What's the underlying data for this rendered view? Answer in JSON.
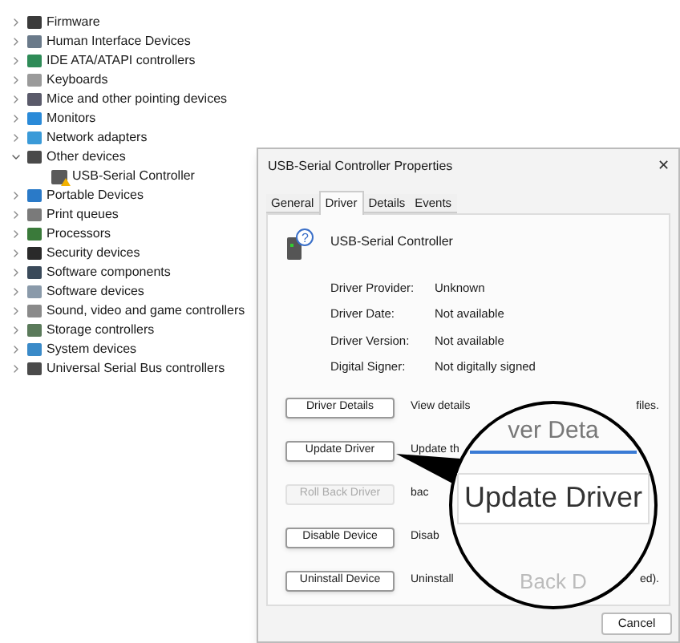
{
  "tree": [
    {
      "label": "Firmware",
      "expanded": false,
      "color": "#3a3a3a"
    },
    {
      "label": "Human Interface Devices",
      "expanded": false,
      "color": "#6a7a8a"
    },
    {
      "label": "IDE ATA/ATAPI controllers",
      "expanded": false,
      "color": "#2e8b57"
    },
    {
      "label": "Keyboards",
      "expanded": false,
      "color": "#9a9a9a"
    },
    {
      "label": "Mice and other pointing devices",
      "expanded": false,
      "color": "#5a5a6a"
    },
    {
      "label": "Monitors",
      "expanded": false,
      "color": "#2a8ad8"
    },
    {
      "label": "Network adapters",
      "expanded": false,
      "color": "#3a9ad8"
    },
    {
      "label": "Other devices",
      "expanded": true,
      "color": "#4a4a4a",
      "children": [
        {
          "label": "USB-Serial Controller",
          "warning": true
        }
      ]
    },
    {
      "label": "Portable Devices",
      "expanded": false,
      "color": "#2a7ac8"
    },
    {
      "label": "Print queues",
      "expanded": false,
      "color": "#7a7a7a"
    },
    {
      "label": "Processors",
      "expanded": false,
      "color": "#3a7a3a"
    },
    {
      "label": "Security devices",
      "expanded": false,
      "color": "#2a2a2a"
    },
    {
      "label": "Software components",
      "expanded": false,
      "color": "#3a4a5a"
    },
    {
      "label": "Software devices",
      "expanded": false,
      "color": "#8a9aaa"
    },
    {
      "label": "Sound, video and game controllers",
      "expanded": false,
      "color": "#8a8a8a"
    },
    {
      "label": "Storage controllers",
      "expanded": false,
      "color": "#5a7a5a"
    },
    {
      "label": "System devices",
      "expanded": false,
      "color": "#3a8ac8"
    },
    {
      "label": "Universal Serial Bus controllers",
      "expanded": false,
      "color": "#4a4a4a"
    }
  ],
  "dialog": {
    "title": "USB-Serial Controller Properties",
    "close": "✕",
    "tabs": [
      {
        "label": "General",
        "selected": false
      },
      {
        "label": "Driver",
        "selected": true
      },
      {
        "label": "Details",
        "selected": false
      },
      {
        "label": "Events",
        "selected": false
      }
    ],
    "device_icon_glyph": "?",
    "device_name": "USB-Serial Controller",
    "properties": [
      {
        "label": "Driver Provider:",
        "value": "Unknown"
      },
      {
        "label": "Driver Date:",
        "value": "Not available"
      },
      {
        "label": "Driver Version:",
        "value": "Not available"
      },
      {
        "label": "Digital Signer:",
        "value": "Not digitally signed"
      }
    ],
    "actions": [
      {
        "button": "Driver Details",
        "disabled": false,
        "description": "View details",
        "description_end": "files."
      },
      {
        "button": "Update Driver",
        "disabled": false,
        "description": "Update th"
      },
      {
        "button": "Roll Back Driver",
        "disabled": true,
        "description": "bac"
      },
      {
        "button": "Disable Device",
        "disabled": false,
        "description": "Disab"
      },
      {
        "button": "Uninstall Device",
        "disabled": false,
        "description": "Uninstall",
        "description_end": "ed)."
      }
    ],
    "footer_buttons": [
      "Cancel"
    ]
  },
  "magnifier": {
    "top_text": "ver Deta",
    "main_text": "Update Driver",
    "bottom_text": "Back D"
  }
}
